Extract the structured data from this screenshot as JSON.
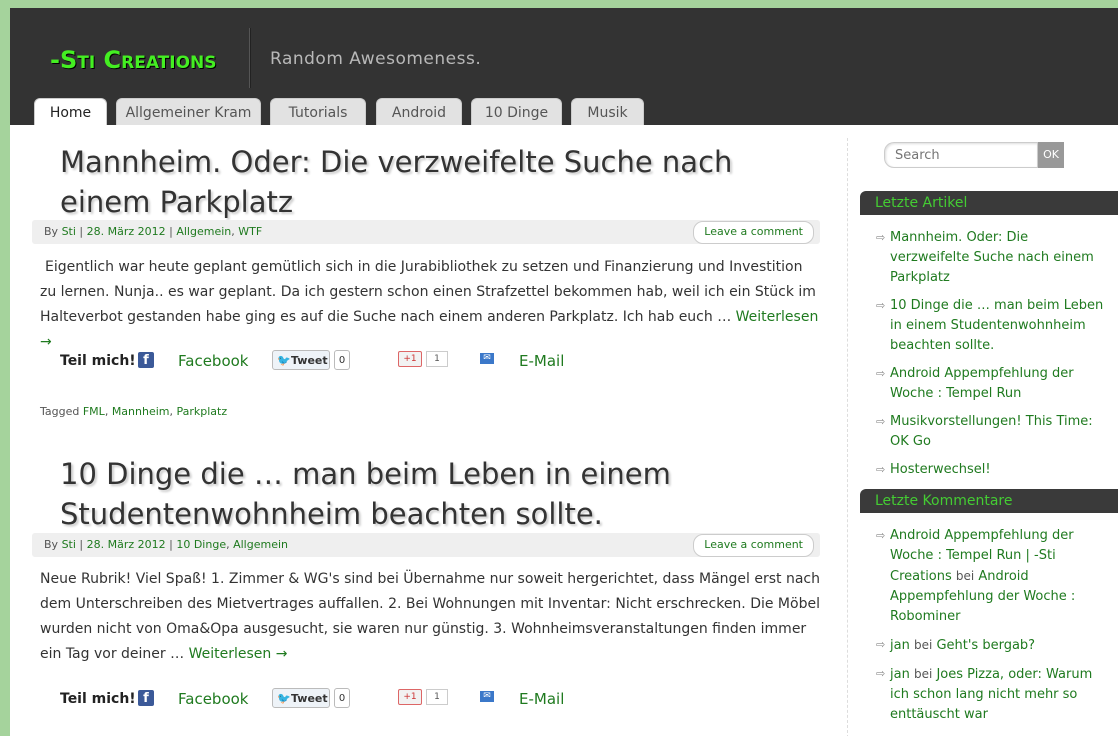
{
  "site": {
    "title": "-Sti Creations",
    "tagline": "Random Awesomeness."
  },
  "nav": {
    "tabs": [
      "Home",
      "Allgemeiner Kram",
      "Tutorials",
      "Android",
      "10 Dinge",
      "Musik"
    ],
    "active": "Home"
  },
  "posts": [
    {
      "title": "Mannheim. Oder: Die verzweifelte Suche nach einem Parkplatz",
      "meta": {
        "by_label": "By",
        "author": "Sti",
        "date": "28. März 2012",
        "categories": [
          "Allgemein",
          "WTF"
        ]
      },
      "comment_label": "Leave a comment",
      "excerpt": "Eigentlich war heute geplant gemütlich sich in die Jurabibliothek zu setzen und Finanzierung und Investition zu lernen. Nunja.. es war geplant. Da ich gestern schon einen Strafzettel bekommen hab, weil ich ein Stück im Halteverbot gestanden habe ging es auf die Suche nach einem anderen Parkplatz. Ich hab euch …",
      "read_more": "Weiterlesen →",
      "tags_label": "Tagged",
      "tags": [
        "FML",
        "Mannheim",
        "Parkplatz"
      ]
    },
    {
      "title": "10 Dinge die … man beim Leben in einem Studentenwohnheim beachten sollte.",
      "meta": {
        "by_label": "By",
        "author": "Sti",
        "date": "28. März 2012",
        "categories": [
          "10 Dinge",
          "Allgemein"
        ]
      },
      "comment_label": "Leave a comment",
      "excerpt": "Neue Rubrik! Viel Spaß!   1. Zimmer & WG's sind bei Übernahme nur soweit hergerichtet, dass Mängel erst nach dem Unterschreiben des Mietvertrages auffallen. 2. Bei Wohnungen mit Inventar: Nicht erschrecken. Die Möbel wurden nicht von Oma&Opa ausgesucht, sie waren nur günstig. 3. Wohnheimsveranstaltungen finden immer ein Tag vor deiner …",
      "read_more": "Weiterlesen →"
    }
  ],
  "share": {
    "label": "Teil mich!",
    "facebook": "Facebook",
    "tweet": "Tweet",
    "tweet_count": "0",
    "gplus": "+1",
    "gplus_count": "1",
    "email": "E-Mail"
  },
  "search": {
    "placeholder": "Search",
    "button": "OK"
  },
  "widgets": {
    "recent_posts": {
      "title": "Letzte Artikel",
      "items": [
        "Mannheim. Oder: Die verzweifelte Suche nach einem Parkplatz",
        "10 Dinge die … man beim Leben in einem Studentenwohnheim beachten sollte.",
        "Android Appempfehlung der Woche : Tempel Run",
        "Musikvorstellungen! This Time: OK Go",
        "Hosterwechsel!"
      ]
    },
    "recent_comments": {
      "title": "Letzte Kommentare",
      "by_word": "bei",
      "items": [
        {
          "author": "Android Appempfehlung der Woche : Tempel Run | -Sti Creations",
          "post": "Android Appempfehlung der Woche : Robominer"
        },
        {
          "author": "jan",
          "post": "Geht's bergab?"
        },
        {
          "author": "jan",
          "post": "Joes Pizza, oder: Warum ich schon lang nicht mehr so enttäuscht war"
        }
      ]
    }
  },
  "colors": {
    "page_bg": "#a5d39c",
    "header_bg": "#333333",
    "logo": "#44ee22",
    "link": "#1f7a1f",
    "widget_head_text": "#44cc33"
  }
}
